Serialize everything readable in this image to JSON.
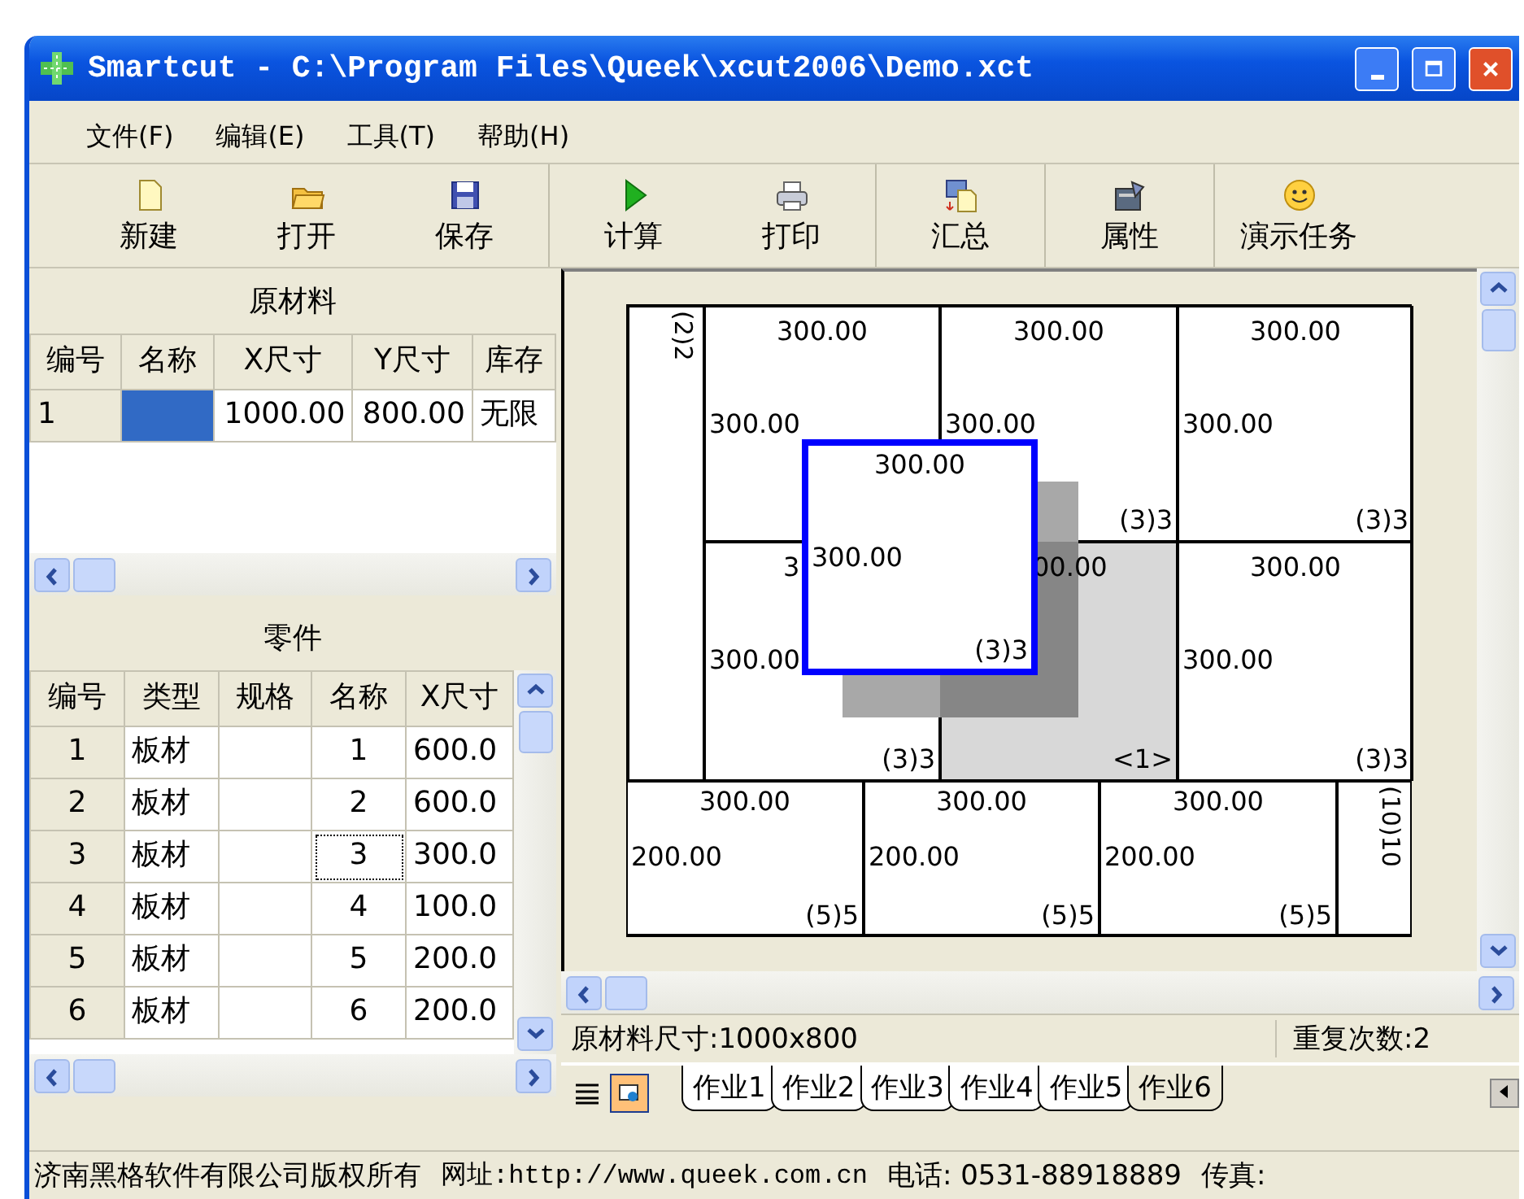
{
  "window": {
    "title": "Smartcut - C:\\Program Files\\Queek\\xcut2006\\Demo.xct"
  },
  "menu": [
    {
      "label": "文件(F)"
    },
    {
      "label": "编辑(E)"
    },
    {
      "label": "工具(T)"
    },
    {
      "label": "帮助(H)"
    }
  ],
  "toolbar": {
    "groups": [
      [
        {
          "label": "新建",
          "kind": "new"
        },
        {
          "label": "打开",
          "kind": "open"
        },
        {
          "label": "保存",
          "kind": "save"
        }
      ],
      [
        {
          "label": "计算",
          "kind": "run"
        },
        {
          "label": "打印",
          "kind": "print"
        }
      ],
      [
        {
          "label": "汇总",
          "kind": "summary"
        }
      ],
      [
        {
          "label": "属性",
          "kind": "properties"
        }
      ],
      [
        {
          "label": "演示任务",
          "kind": "demo"
        }
      ]
    ]
  },
  "materials": {
    "title": "原材料",
    "columns": [
      "编号",
      "名称",
      "X尺寸",
      "Y尺寸",
      "库存"
    ],
    "rows": [
      {
        "cells": [
          {
            "text": "1",
            "selected": false
          },
          {
            "selected": true
          },
          {
            "text": "1000.00",
            "selected": false
          },
          {
            "text": "800.00",
            "selected": false
          },
          {
            "text": "无限",
            "selected": false
          }
        ]
      }
    ]
  },
  "parts": {
    "title": "零件",
    "columns": [
      "编号",
      "类型",
      "规格",
      "名称",
      "X尺寸"
    ],
    "rows": [
      {
        "cells": [
          {
            "text": "1",
            "focused": false
          },
          {
            "text": "板材",
            "focused": false
          },
          {
            "focused": false
          },
          {
            "text": "1",
            "focused": false
          },
          {
            "text": "600.0",
            "focused": false
          }
        ]
      },
      {
        "cells": [
          {
            "text": "2",
            "focused": false
          },
          {
            "text": "板材",
            "focused": false
          },
          {
            "focused": false
          },
          {
            "text": "2",
            "focused": false
          },
          {
            "text": "600.0",
            "focused": false
          }
        ]
      },
      {
        "cells": [
          {
            "text": "3",
            "focused": false
          },
          {
            "text": "板材",
            "focused": false
          },
          {
            "focused": false
          },
          {
            "text": "3",
            "focused": true
          },
          {
            "text": "300.0",
            "focused": false
          }
        ]
      },
      {
        "cells": [
          {
            "text": "4",
            "focused": false
          },
          {
            "text": "板材",
            "focused": false
          },
          {
            "focused": false
          },
          {
            "text": "4",
            "focused": false
          },
          {
            "text": "100.0",
            "focused": false
          }
        ]
      },
      {
        "cells": [
          {
            "text": "5",
            "focused": false
          },
          {
            "text": "板材",
            "focused": false
          },
          {
            "focused": false
          },
          {
            "text": "5",
            "focused": false
          },
          {
            "text": "200.0",
            "focused": false
          }
        ]
      },
      {
        "cells": [
          {
            "text": "6",
            "focused": false
          },
          {
            "text": "板材",
            "focused": false
          },
          {
            "focused": false
          },
          {
            "text": "6",
            "focused": false
          },
          {
            "text": "200.0",
            "focused": false
          }
        ]
      }
    ]
  },
  "layout": {
    "pieces": [
      {
        "kind": "strip",
        "tag": "(2)2",
        "highlighted": false
      },
      {
        "kind": "rect",
        "width_label": "300.00",
        "height_label": "300.00",
        "highlighted": false
      },
      {
        "kind": "rect",
        "width_label": "300.00",
        "height_label": "300.00",
        "tag": "(3)3",
        "highlighted": false
      },
      {
        "kind": "rect",
        "width_label": "300.00",
        "height_label": "300.00",
        "tag": "(3)3",
        "highlighted": false
      },
      {
        "kind": "rect",
        "width_label": "3",
        "height_label": "300.00",
        "tag": "(3)3",
        "highlighted": false
      },
      {
        "kind": "rect",
        "width_label": "00.00",
        "tag": "<1>",
        "highlighted": true
      },
      {
        "kind": "rect",
        "width_label": "300.00",
        "height_label": "300.00",
        "tag": "(3)3",
        "highlighted": false
      },
      {
        "kind": "rect",
        "width_label": "300.00",
        "height_label": "200.00",
        "tag": "(5)5",
        "highlighted": false
      },
      {
        "kind": "rect",
        "width_label": "300.00",
        "height_label": "200.00",
        "tag": "(5)5",
        "highlighted": false
      },
      {
        "kind": "rect",
        "width_label": "300.00",
        "height_label": "200.00",
        "tag": "(5)5",
        "highlighted": false
      },
      {
        "kind": "strip",
        "tag": "(10)10",
        "highlighted": false
      }
    ],
    "dragged": {
      "width_label": "300.00",
      "height_label": "300.00",
      "tag": "(3)3"
    }
  },
  "info_bar": {
    "sheet_size": "原材料尺寸:1000x800",
    "repeat": "重复次数:2"
  },
  "tabs": [
    {
      "label": "作业1",
      "selected": false
    },
    {
      "label": "作业2",
      "selected": false
    },
    {
      "label": "作业3",
      "selected": false
    },
    {
      "label": "作业4",
      "selected": false
    },
    {
      "label": "作业5",
      "selected": false
    },
    {
      "label": "作业6",
      "selected": true
    }
  ],
  "footer": {
    "copyright": "济南黑格软件有限公司版权所有",
    "website": "网址:http://www.queek.com.cn",
    "phone": "电话: 0531-88918889",
    "fax": "传真:"
  }
}
